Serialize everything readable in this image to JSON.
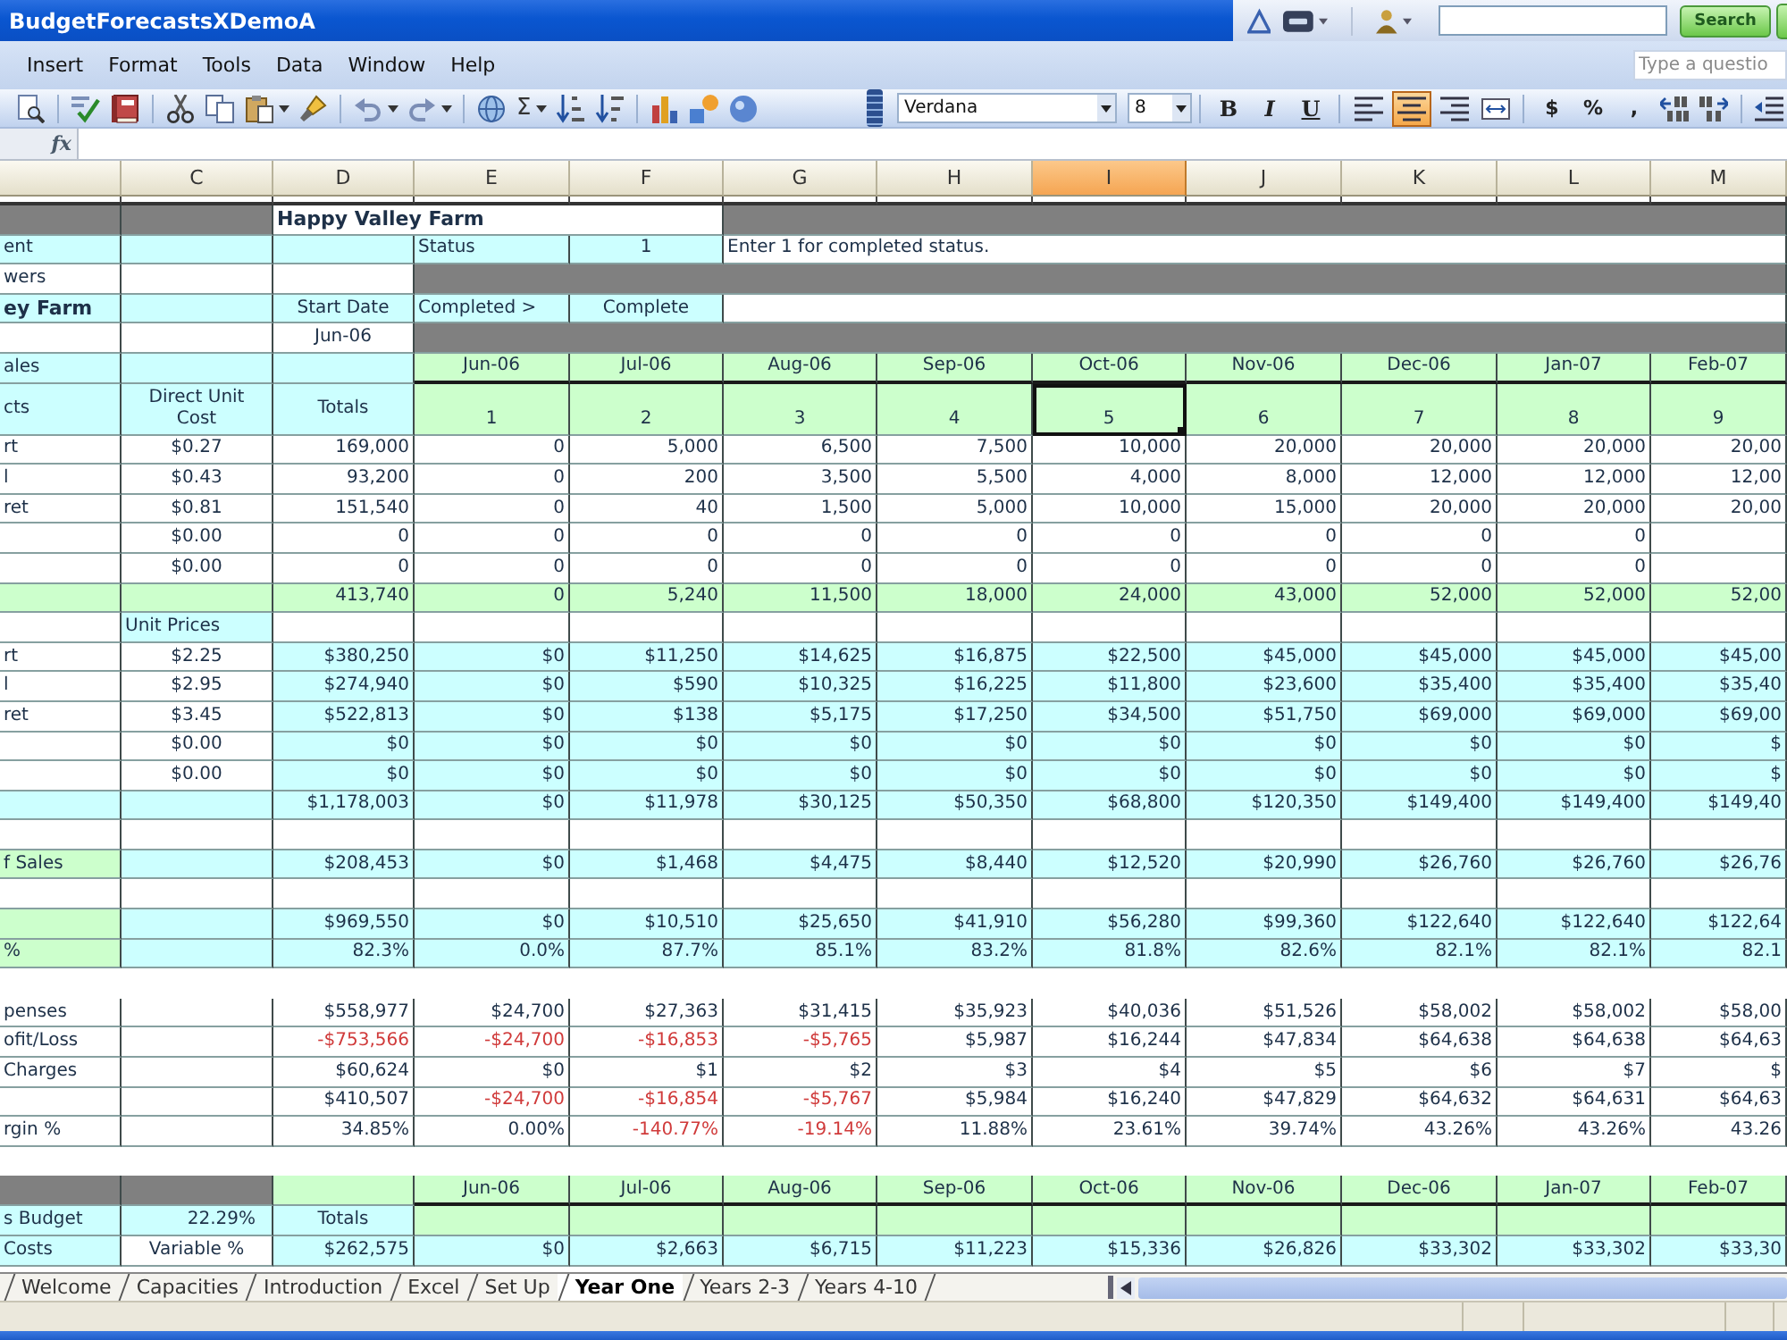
{
  "window": {
    "title": "BudgetForecastsXDemoA",
    "search_button": "Search"
  },
  "menu": [
    "Insert",
    "Format",
    "Tools",
    "Data",
    "Window",
    "Help"
  ],
  "help_box": {
    "placeholder": "Type a questio"
  },
  "standard_toolbar": {
    "autosum": "Σ"
  },
  "formatting_toolbar": {
    "font": "Verdana",
    "font_size": "8",
    "bold": "B",
    "italic": "I",
    "underline": "U",
    "align": [
      {
        "selected": false
      },
      {
        "selected": true
      },
      {
        "selected": false
      }
    ],
    "currency": "$",
    "percent": "%",
    "comma": ","
  },
  "formula_bar": {
    "function_label": "fx"
  },
  "sheet": {
    "columns": [
      {
        "selected": false
      },
      {
        "label": "C",
        "selected": false
      },
      {
        "label": "D",
        "selected": false
      },
      {
        "label": "E",
        "selected": false
      },
      {
        "label": "F",
        "selected": false
      },
      {
        "label": "G",
        "selected": false
      },
      {
        "label": "H",
        "selected": false
      },
      {
        "label": "I",
        "selected": true
      },
      {
        "label": "J",
        "selected": false
      },
      {
        "label": "K",
        "selected": false
      },
      {
        "label": "L",
        "selected": false
      },
      {
        "label": "M",
        "selected": false
      }
    ],
    "rows": [
      {
        "kind": "data",
        "color": "#808080",
        "cells": [
          null,
          null,
          {
            "text": "Happy Valley Farm",
            "kind": "note",
            "bold": true,
            "color": "#ffffff"
          },
          null,
          null,
          {
            "kind": "note"
          },
          null,
          null,
          null,
          null,
          null,
          null
        ]
      },
      {
        "kind": "data",
        "color": "#ccffff",
        "cells": [
          "ent",
          null,
          null,
          {
            "text": "Status",
            "kind": "label"
          },
          {
            "text": "1",
            "kind": "heading"
          },
          {
            "text": "Enter 1 for completed status.",
            "kind": "note",
            "color": "#ffffff"
          },
          null,
          null,
          null,
          null,
          null,
          null
        ]
      },
      {
        "kind": "data",
        "color": "#ffffff",
        "cells": [
          "wers",
          null,
          null,
          {
            "kind": "note",
            "color": "#808080"
          },
          null,
          null,
          null,
          null,
          null,
          null,
          null,
          null
        ]
      },
      {
        "kind": "data",
        "color": "#ccffff",
        "cells": [
          {
            "text": "ey Farm",
            "bold": true
          },
          null,
          {
            "text": "Start Date",
            "kind": "heading"
          },
          {
            "text": "Completed >",
            "kind": "label"
          },
          {
            "text": "Complete",
            "kind": "heading"
          },
          {
            "kind": "note",
            "color": "#ffffff"
          },
          null,
          null,
          null,
          null,
          null,
          null
        ]
      },
      {
        "kind": "data",
        "color": "#ffffff",
        "cells": [
          null,
          null,
          {
            "text": "Jun-06",
            "kind": "heading"
          },
          {
            "kind": "note",
            "color": "#808080"
          },
          null,
          null,
          null,
          null,
          null,
          null,
          null,
          null
        ]
      },
      {
        "kind": "months",
        "color": "#ccffcc",
        "cells": [
          {
            "text": "ales",
            "color": "#ccffff"
          },
          {
            "color": "#ccffff"
          },
          {
            "color": "#ccffff"
          },
          "Jun-06",
          "Jul-06",
          "Aug-06",
          "Sep-06",
          "Oct-06",
          "Nov-06",
          "Dec-06",
          "Jan-07",
          "Feb-07"
        ]
      },
      {
        "kind": "header",
        "color": "#ccffcc",
        "cells": [
          {
            "text": "cts",
            "color": "#ccffff"
          },
          {
            "text": "Direct Unit Cost",
            "color": "#ccffff"
          },
          {
            "text": "Totals",
            "color": "#ccffff"
          },
          "1",
          "2",
          "3",
          "4",
          {
            "text": "5",
            "selected": true
          },
          "6",
          "7",
          "8",
          "9"
        ]
      },
      {
        "kind": "data",
        "color": "#ffffff",
        "cells": [
          "rt",
          "$0.27",
          "169,000",
          "0",
          "5,000",
          "6,500",
          "7,500",
          "10,000",
          "20,000",
          "20,000",
          "20,000",
          "20,00"
        ]
      },
      {
        "kind": "data",
        "color": "#ffffff",
        "cells": [
          "l",
          "$0.43",
          "93,200",
          "0",
          "200",
          "3,500",
          "5,500",
          "4,000",
          "8,000",
          "12,000",
          "12,000",
          "12,00"
        ]
      },
      {
        "kind": "data",
        "color": "#ffffff",
        "cells": [
          "ret",
          "$0.81",
          "151,540",
          "0",
          "40",
          "1,500",
          "5,000",
          "10,000",
          "15,000",
          "20,000",
          "20,000",
          "20,00"
        ]
      },
      {
        "kind": "data",
        "color": "#ffffff",
        "cells": [
          null,
          "$0.00",
          "0",
          "0",
          "0",
          "0",
          "0",
          "0",
          "0",
          "0",
          "0",
          null
        ]
      },
      {
        "kind": "data",
        "color": "#ffffff",
        "cells": [
          null,
          "$0.00",
          "0",
          "0",
          "0",
          "0",
          "0",
          "0",
          "0",
          "0",
          "0",
          null
        ]
      },
      {
        "kind": "data",
        "color": "#ccffcc",
        "cells": [
          null,
          null,
          "413,740",
          "0",
          "5,240",
          "11,500",
          "18,000",
          "24,000",
          "43,000",
          "52,000",
          "52,000",
          "52,00"
        ]
      },
      {
        "kind": "data",
        "color": "#ffffff",
        "cells": [
          null,
          {
            "text": "Unit Prices",
            "kind": "label",
            "color": "#ccffff"
          },
          null,
          null,
          null,
          null,
          null,
          null,
          null,
          null,
          null,
          null
        ]
      },
      {
        "kind": "data",
        "color": "#ccffff",
        "cells": [
          {
            "text": "rt",
            "color": "#ffffff"
          },
          {
            "text": "$2.25",
            "color": "#ffffff"
          },
          "$380,250",
          "$0",
          "$11,250",
          "$14,625",
          "$16,875",
          "$22,500",
          "$45,000",
          "$45,000",
          "$45,000",
          "$45,00"
        ]
      },
      {
        "kind": "data",
        "color": "#ccffff",
        "cells": [
          {
            "text": "l",
            "color": "#ffffff"
          },
          {
            "text": "$2.95",
            "color": "#ffffff"
          },
          "$274,940",
          "$0",
          "$590",
          "$10,325",
          "$16,225",
          "$11,800",
          "$23,600",
          "$35,400",
          "$35,400",
          "$35,40"
        ]
      },
      {
        "kind": "data",
        "color": "#ccffff",
        "cells": [
          {
            "text": "ret",
            "color": "#ffffff"
          },
          {
            "text": "$3.45",
            "color": "#ffffff"
          },
          "$522,813",
          "$0",
          "$138",
          "$5,175",
          "$17,250",
          "$34,500",
          "$51,750",
          "$69,000",
          "$69,000",
          "$69,00"
        ]
      },
      {
        "kind": "data",
        "color": "#ccffff",
        "cells": [
          {
            "color": "#ffffff"
          },
          {
            "text": "$0.00",
            "color": "#ffffff"
          },
          "$0",
          "$0",
          "$0",
          "$0",
          "$0",
          "$0",
          "$0",
          "$0",
          "$0",
          "$"
        ]
      },
      {
        "kind": "data",
        "color": "#ccffff",
        "cells": [
          {
            "color": "#ffffff"
          },
          {
            "text": "$0.00",
            "color": "#ffffff"
          },
          "$0",
          "$0",
          "$0",
          "$0",
          "$0",
          "$0",
          "$0",
          "$0",
          "$0",
          "$"
        ]
      },
      {
        "kind": "data",
        "color": "#ccffff",
        "cells": [
          null,
          null,
          "$1,178,003",
          "$0",
          "$11,978",
          "$30,125",
          "$50,350",
          "$68,800",
          "$120,350",
          "$149,400",
          "$149,400",
          "$149,40"
        ]
      },
      {
        "kind": "data",
        "color": "#ffffff",
        "cells": [
          null,
          null,
          null,
          null,
          null,
          null,
          null,
          null,
          null,
          null,
          null,
          null
        ]
      },
      {
        "kind": "data",
        "color": "#ccffff",
        "cells": [
          {
            "text": "f Sales",
            "color": "#ccffcc"
          },
          null,
          "$208,453",
          "$0",
          "$1,468",
          "$4,475",
          "$8,440",
          "$12,520",
          "$20,990",
          "$26,760",
          "$26,760",
          "$26,76"
        ]
      },
      {
        "kind": "data",
        "color": "#ffffff",
        "cells": [
          null,
          null,
          null,
          null,
          null,
          null,
          null,
          null,
          null,
          null,
          null,
          null
        ]
      },
      {
        "kind": "data",
        "color": "#ccffff",
        "cells": [
          {
            "color": "#ccffcc"
          },
          null,
          "$969,550",
          "$0",
          "$10,510",
          "$25,650",
          "$41,910",
          "$56,280",
          "$99,360",
          "$122,640",
          "$122,640",
          "$122,64"
        ]
      },
      {
        "kind": "data",
        "color": "#ccffff",
        "cells": [
          {
            "text": "%",
            "color": "#ccffcc"
          },
          null,
          "82.3%",
          "0.0%",
          "87.7%",
          "85.1%",
          "83.2%",
          "81.8%",
          "82.6%",
          "82.1%",
          "82.1%",
          "82.1"
        ]
      },
      {
        "kind": "gap",
        "color": "#ffffff",
        "cells": [
          null,
          null,
          null,
          null,
          null,
          null,
          null,
          null,
          null,
          null,
          null,
          null
        ]
      },
      {
        "kind": "data",
        "color": "#ffffff",
        "cells": [
          "penses",
          null,
          "$558,977",
          "$24,700",
          "$27,363",
          "$31,415",
          "$35,923",
          "$40,036",
          "$51,526",
          "$58,002",
          "$58,002",
          "$58,00"
        ]
      },
      {
        "kind": "data",
        "color": "#ffffff",
        "cells": [
          "ofit/Loss",
          null,
          {
            "text": "-$753,566",
            "negative": true
          },
          {
            "text": "-$24,700",
            "negative": true
          },
          {
            "text": "-$16,853",
            "negative": true
          },
          {
            "text": "-$5,765",
            "negative": true
          },
          "$5,987",
          "$16,244",
          "$47,834",
          "$64,638",
          "$64,638",
          "$64,63"
        ]
      },
      {
        "kind": "data",
        "color": "#ffffff",
        "cells": [
          "Charges",
          null,
          "$60,624",
          "$0",
          "$1",
          "$2",
          "$3",
          "$4",
          "$5",
          "$6",
          "$7",
          "$"
        ]
      },
      {
        "kind": "data",
        "color": "#ffffff",
        "cells": [
          null,
          null,
          "$410,507",
          {
            "text": "-$24,700",
            "negative": true
          },
          {
            "text": "-$16,854",
            "negative": true
          },
          {
            "text": "-$5,767",
            "negative": true
          },
          "$5,984",
          "$16,240",
          "$47,829",
          "$64,632",
          "$64,631",
          "$64,63"
        ]
      },
      {
        "kind": "data",
        "color": "#ffffff",
        "cells": [
          "rgin %",
          null,
          "34.85%",
          "0.00%",
          {
            "text": "-140.77%",
            "negative": true
          },
          {
            "text": "-19.14%",
            "negative": true
          },
          "11.88%",
          "23.61%",
          "39.74%",
          "43.26%",
          "43.26%",
          "43.26"
        ]
      },
      {
        "kind": "gap",
        "color": "#ffffff",
        "cells": [
          null,
          null,
          null,
          null,
          null,
          null,
          null,
          null,
          null,
          null,
          null,
          null
        ]
      },
      {
        "kind": "months",
        "color": "#ccffcc",
        "cells": [
          {
            "color": "#808080"
          },
          {
            "color": "#808080"
          },
          null,
          "Jun-06",
          "Jul-06",
          "Aug-06",
          "Sep-06",
          "Oct-06",
          "Nov-06",
          "Dec-06",
          "Jan-07",
          "Feb-07"
        ]
      },
      {
        "kind": "header",
        "color": "#ccffcc",
        "cells": [
          {
            "text": "s Budget",
            "color": "#ccffff"
          },
          {
            "text": "22.29%",
            "kind": "figure",
            "color": "#ccffff"
          },
          {
            "text": "Totals",
            "color": "#ccffff"
          },
          null,
          null,
          null,
          null,
          null,
          null,
          null,
          null,
          null
        ]
      },
      {
        "kind": "data",
        "color": "#ccffff",
        "cells": [
          "Costs",
          {
            "text": "Variable %",
            "color": "#ffffff"
          },
          "$262,575",
          "$0",
          "$2,663",
          "$6,715",
          "$11,223",
          "$15,336",
          "$26,826",
          "$33,302",
          "$33,302",
          "$33,30"
        ]
      }
    ]
  },
  "sheet_tabs": [
    {
      "label": "Welcome",
      "selected": false
    },
    {
      "label": "Capacities",
      "selected": false
    },
    {
      "label": "Introduction",
      "selected": false
    },
    {
      "label": "Excel",
      "selected": false
    },
    {
      "label": "Set Up",
      "selected": false
    },
    {
      "label": "Year One",
      "selected": true
    },
    {
      "label": "Years 2-3",
      "selected": false
    },
    {
      "label": "Years 4-10",
      "selected": false
    }
  ]
}
